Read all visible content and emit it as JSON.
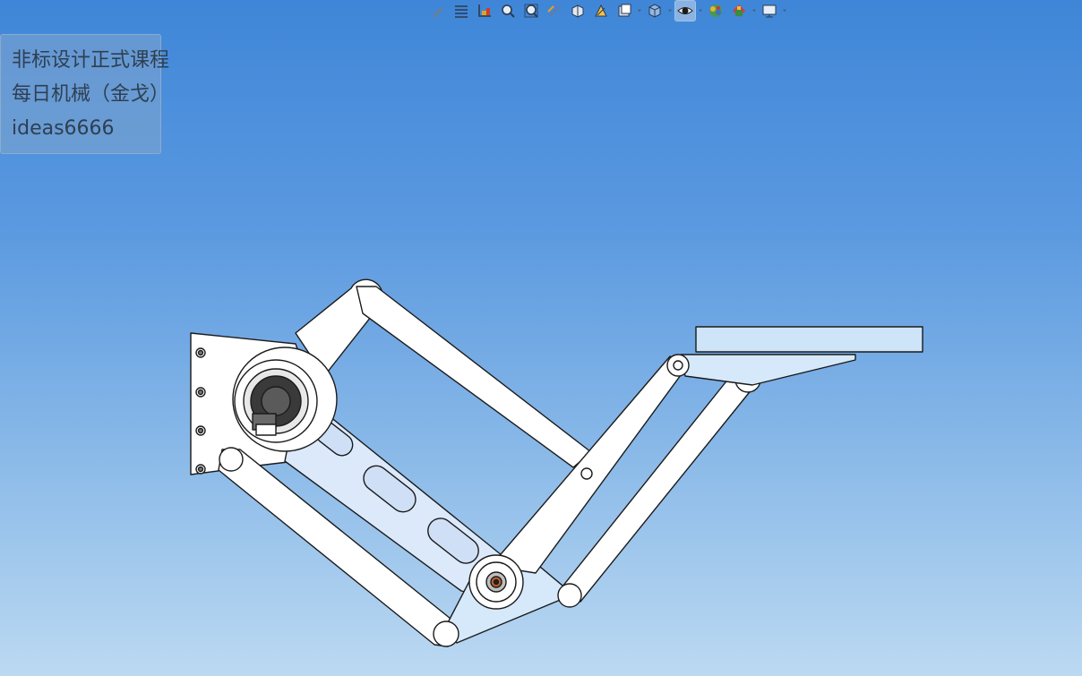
{
  "toolbar": {
    "buttons": [
      {
        "icon": "sketch-pencil-icon"
      },
      {
        "icon": "lines-icon"
      },
      {
        "icon": "coordinate-axes-icon"
      },
      {
        "icon": "zoom-to-area-icon"
      },
      {
        "icon": "zoom-to-fit-icon"
      },
      {
        "icon": "section-view-icon"
      },
      {
        "icon": "view-orientation-icon"
      },
      {
        "icon": "dynamic-annotation-icon"
      },
      {
        "icon": "display-style-icon"
      },
      {
        "icon": "standard-views-icon"
      },
      {
        "icon": "hide-show-items-icon",
        "active": true
      },
      {
        "icon": "edit-appearance-icon"
      },
      {
        "icon": "apply-scene-icon"
      },
      {
        "icon": "view-settings-icon"
      }
    ]
  },
  "watermark": {
    "line1": "非标设计正式课程",
    "line2": "每日机械（金戈）",
    "line3": "ideas6666"
  },
  "colors": {
    "background_top": "#3f86d8",
    "background_bottom": "#bcd9f2",
    "part_white": "#ffffff",
    "part_light_blue": "#d6e9fb",
    "outline": "#1b1b1b"
  }
}
